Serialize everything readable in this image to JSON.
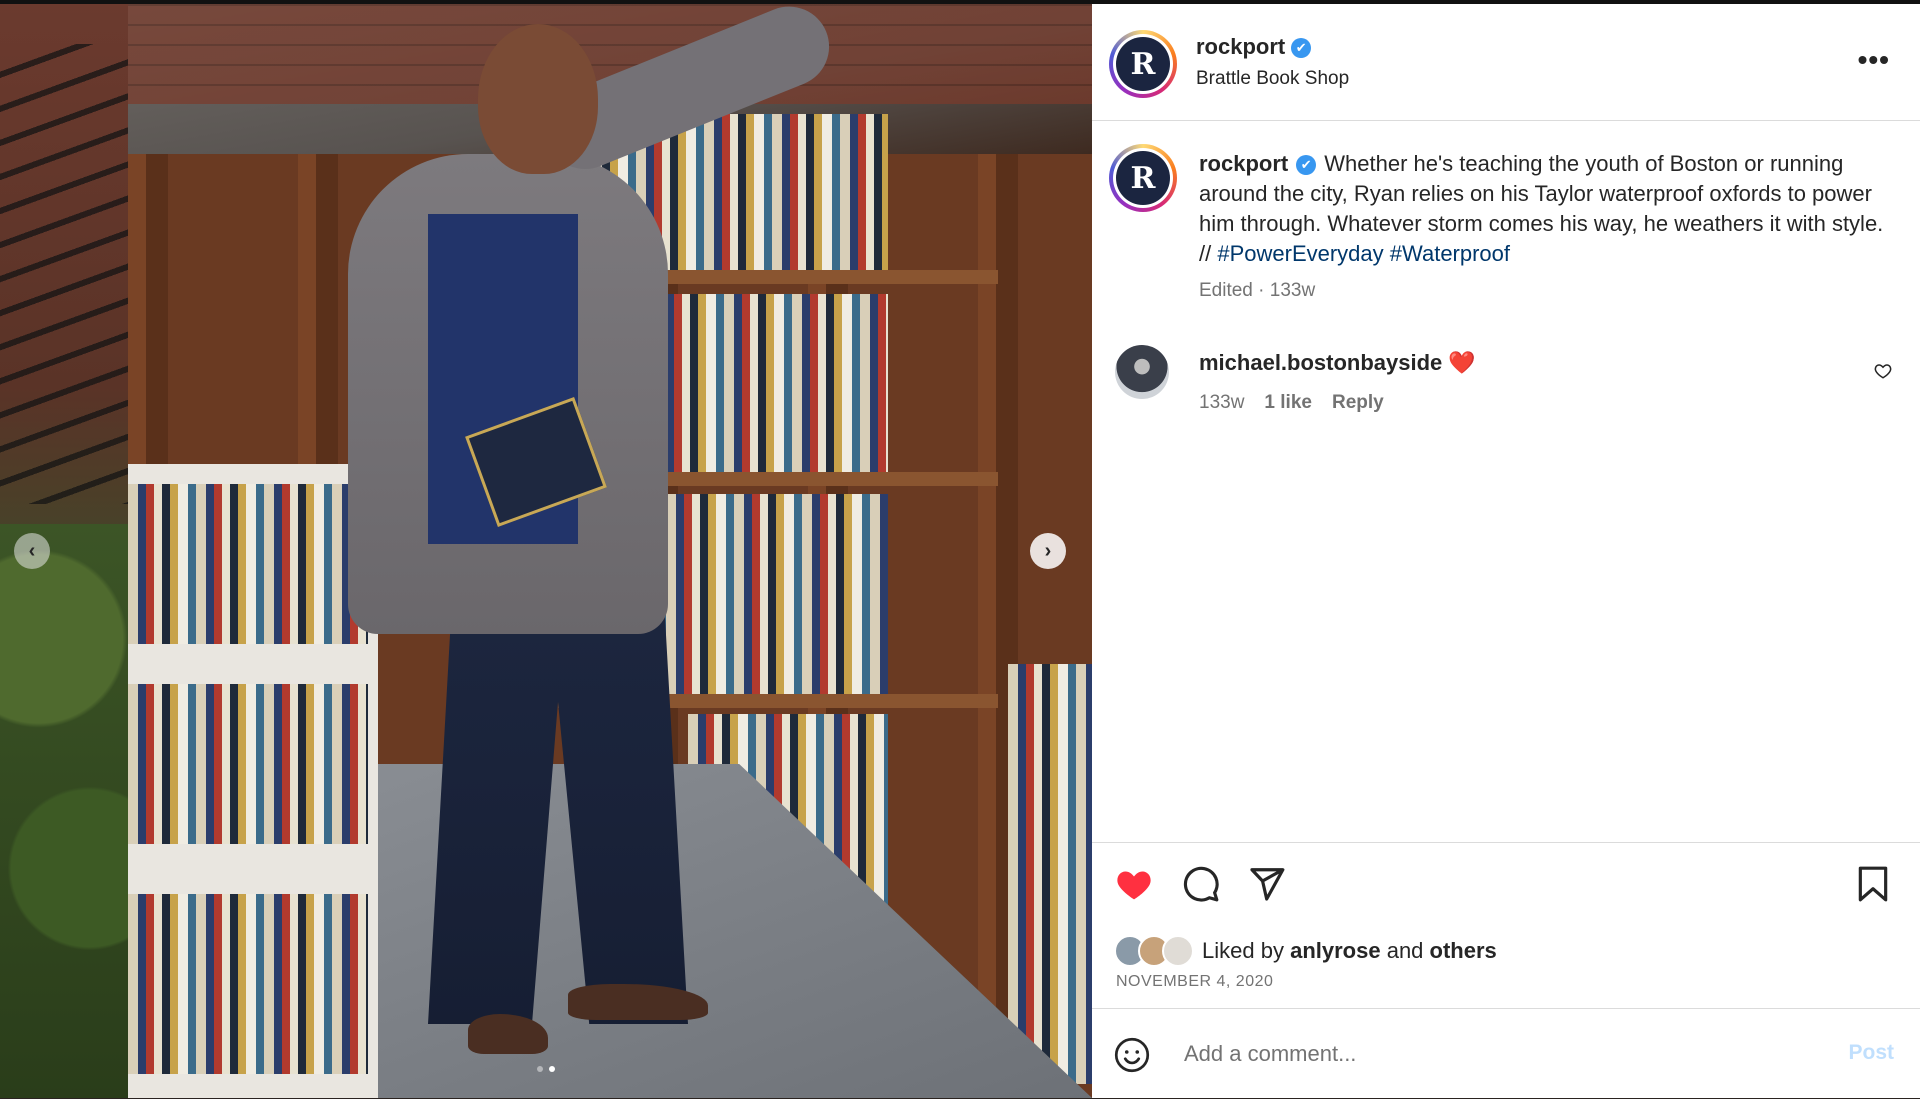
{
  "post": {
    "account": "rockport",
    "avatar_letter": "R",
    "location": "Brattle Book Shop",
    "more_label": "•••",
    "verified_glyph": "✔"
  },
  "caption": {
    "username": "rockport",
    "text": "Whether he's teaching the youth of Boston or running around the city, Ryan relies on his Taylor waterproof oxfords to power him through. Whatever storm comes his way, he weathers it with style. // ",
    "hashtags": [
      "#PowerEveryday",
      "#Waterproof"
    ],
    "meta": "Edited · 133w"
  },
  "comment": {
    "username": "michael.bostonbayside",
    "emoji": "❤️",
    "time": "133w",
    "likes": "1 like",
    "reply": "Reply"
  },
  "engagement": {
    "liked_by_prefix": "Liked by",
    "liked_by_user": "anlyrose",
    "liked_by_and": "and",
    "liked_by_others": "others",
    "date": "NOVEMBER 4, 2020",
    "liked": true
  },
  "composer": {
    "placeholder": "Add a comment...",
    "post_label": "Post"
  },
  "carousel": {
    "prev_glyph": "‹",
    "next_glyph": "›",
    "slide_count": 2,
    "active_index": 1
  },
  "icons": {
    "like": "heart-icon",
    "comment": "comment-icon",
    "share": "send-icon",
    "save": "bookmark-icon",
    "emoji": "smiley-icon"
  },
  "colors": {
    "like_red": "#ff3040",
    "hashtag": "#00376b",
    "verified": "#3897f0",
    "post_disabled": "#c0dffd"
  }
}
